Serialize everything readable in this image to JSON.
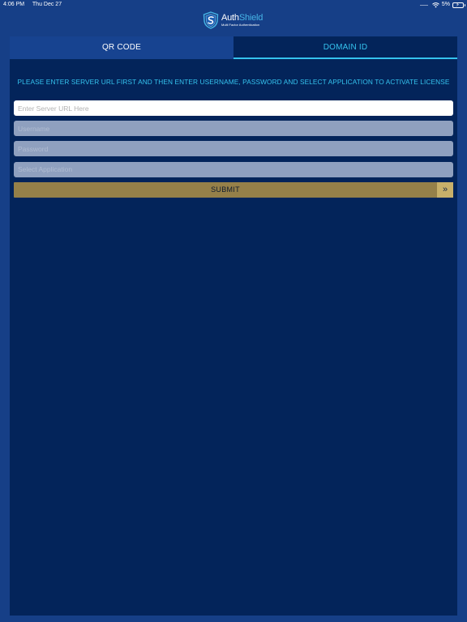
{
  "status_bar": {
    "time": "4:06 PM",
    "date": "Thu Dec 27",
    "battery_text": "5%",
    "icons": [
      "signal-icon",
      "wifi-icon",
      "battery-charging-icon"
    ]
  },
  "header": {
    "logo_part1": "Auth",
    "logo_part2": "Shield",
    "logo_sub": "Multi Factor Authentication",
    "colors": {
      "brand_light": "#46b4e6",
      "brand_white": "#ffffff"
    }
  },
  "tabs": [
    {
      "label": "QR CODE",
      "active": false
    },
    {
      "label": "DOMAIN ID",
      "active": true
    }
  ],
  "instruction": "PLEASE ENTER SERVER URL FIRST AND THEN ENTER USERNAME, PASSWORD AND SELECT APPLICATION TO ACTIVATE LICENSE",
  "form": {
    "server_url": {
      "value": "",
      "placeholder": "Enter Server URL Here"
    },
    "username": {
      "value": "",
      "placeholder": "Username"
    },
    "password": {
      "value": "",
      "placeholder": "Password"
    },
    "application": {
      "selected": "",
      "placeholder": "Select Application"
    },
    "submit_label": "SUBMIT",
    "submit_icon": "double-chevron-right-icon"
  },
  "colors": {
    "background": "#163f87",
    "panel": "#03245a",
    "accent": "#35c3ee",
    "submit": "#958049",
    "submit_arrow": "#c8b06a"
  }
}
